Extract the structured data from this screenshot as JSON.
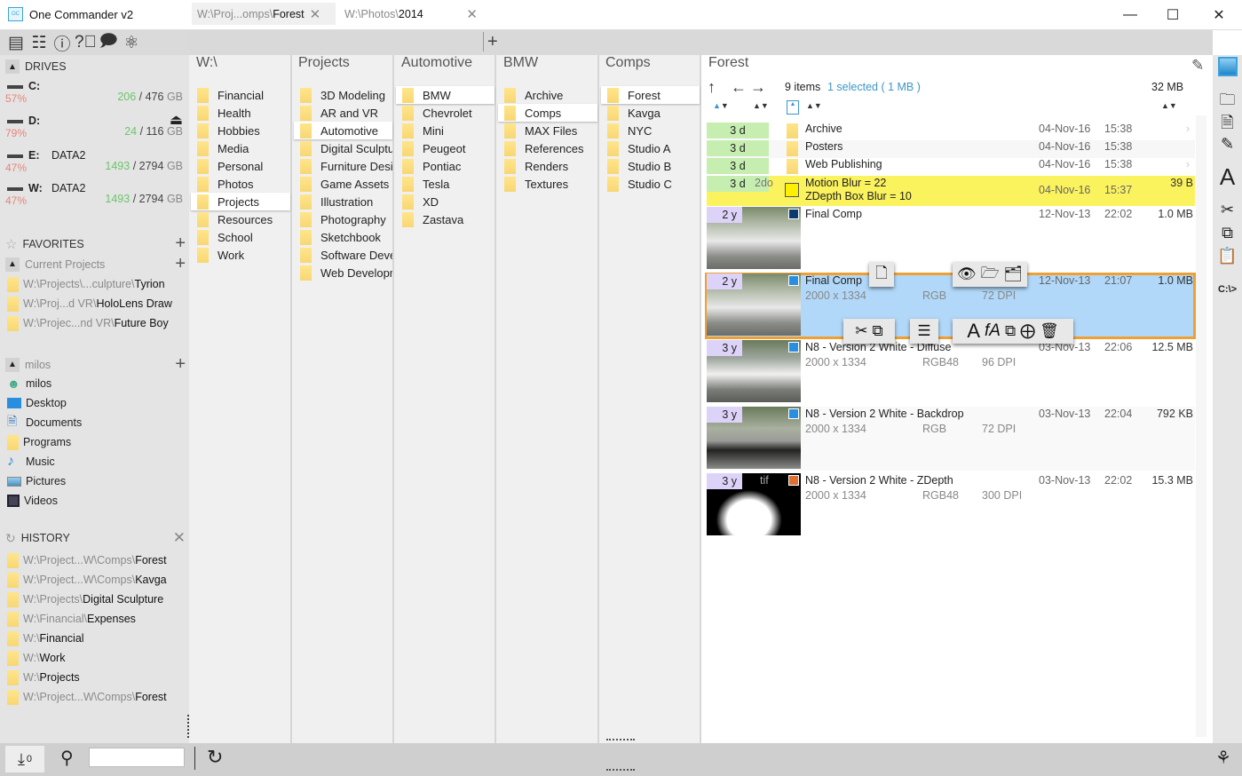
{
  "window": {
    "title": "One Commander v2",
    "app_icon": "OC",
    "controls": [
      "minimize",
      "maximize",
      "close"
    ]
  },
  "sidebar": {
    "toolbar_icons": [
      "columns-icon",
      "sliders-icon",
      "info-icon",
      "help-icon",
      "chat-icon",
      "atom-icon"
    ],
    "drives_header": "DRIVES",
    "drives": [
      {
        "letter": "C:",
        "label": "",
        "percent": "57%",
        "free": "206",
        "total": "476",
        "unit": "GB"
      },
      {
        "letter": "D:",
        "label": "",
        "percent": "79%",
        "free": "24",
        "total": "116",
        "unit": "GB",
        "eject": true
      },
      {
        "letter": "E:",
        "label": "DATA2",
        "percent": "47%",
        "free": "1493",
        "total": "2794",
        "unit": "GB"
      },
      {
        "letter": "W:",
        "label": "DATA2",
        "percent": "47%",
        "free": "1493",
        "total": "2794",
        "unit": "GB"
      }
    ],
    "favorites_header": "FAVORITES",
    "current_projects_header": "Current Projects",
    "favorites": [
      {
        "prefix": "W:\\Projects\\...culpture\\",
        "name": "Tyrion"
      },
      {
        "prefix": "W:\\Proj...d VR\\",
        "name": "HoloLens Draw"
      },
      {
        "prefix": "W:\\Projec...nd VR\\",
        "name": "Future Boy"
      }
    ],
    "user_header": "milos",
    "user_items": [
      {
        "icon": "user-icon",
        "label": "milos"
      },
      {
        "icon": "desktop-icon",
        "label": "Desktop"
      },
      {
        "icon": "document-icon",
        "label": "Documents"
      },
      {
        "icon": "folder-icon",
        "label": "Programs"
      },
      {
        "icon": "music-icon",
        "label": "Music"
      },
      {
        "icon": "pictures-icon",
        "label": "Pictures"
      },
      {
        "icon": "video-icon",
        "label": "Videos"
      }
    ],
    "history_header": "HISTORY",
    "history": [
      {
        "prefix": "W:\\Project...W\\Comps\\",
        "name": "Forest"
      },
      {
        "prefix": "W:\\Project...W\\Comps\\",
        "name": "Kavga"
      },
      {
        "prefix": "W:\\Projects\\",
        "name": "Digital Sculpture"
      },
      {
        "prefix": "W:\\Financial\\",
        "name": "Expenses"
      },
      {
        "prefix": "W:\\",
        "name": "Financial"
      },
      {
        "prefix": "W:\\",
        "name": "Work"
      },
      {
        "prefix": "W:\\",
        "name": "Projects"
      },
      {
        "prefix": "W:\\Project...W\\Comps\\",
        "name": "Forest"
      }
    ]
  },
  "tabs": [
    {
      "prefix": "W:\\Proj...omps\\",
      "name": "Forest",
      "active": true
    },
    {
      "prefix": "W:\\Photos\\",
      "name": "2014",
      "active": false
    }
  ],
  "columns": [
    {
      "title": "W:\\",
      "items": [
        "Financial",
        "Health",
        "Hobbies",
        "Media",
        "Personal",
        "Photos",
        "Projects",
        "Resources",
        "School",
        "Work"
      ],
      "selected": 6
    },
    {
      "title": "Projects",
      "items": [
        "3D Modeling",
        "AR and VR",
        "Automotive",
        "Digital Sculpture",
        "Furniture Design",
        "Game Assets",
        "Illustration",
        "Photography",
        "Sketchbook",
        "Software Development",
        "Web Development"
      ],
      "selected": 2
    },
    {
      "title": "Automotive",
      "items": [
        "BMW",
        "Chevrolet",
        "Mini",
        "Peugeot",
        "Pontiac",
        "Tesla",
        "XD",
        "Zastava"
      ],
      "selected": 0
    },
    {
      "title": "BMW",
      "items": [
        "Archive",
        "Comps",
        "MAX Files",
        "References",
        "Renders",
        "Textures"
      ],
      "selected": 1
    },
    {
      "title": "Comps",
      "items": [
        "Forest",
        "Kavga",
        "NYC",
        "Studio A",
        "Studio B",
        "Studio C"
      ],
      "selected": 0
    }
  ],
  "file_pane": {
    "title": "Forest",
    "item_count": "9 items",
    "selected_info": "1 selected ( 1 MB )",
    "total_size": "32 MB",
    "folders": [
      {
        "age": "3 d",
        "name": "Archive",
        "date": "04-Nov-16",
        "time": "15:38"
      },
      {
        "age": "3 d",
        "name": "Posters",
        "date": "04-Nov-16",
        "time": "15:38"
      },
      {
        "age": "3 d",
        "name": "Web Publishing",
        "date": "04-Nov-16",
        "time": "15:38"
      }
    ],
    "note": {
      "age": "3 d",
      "tag": "2do",
      "line1": "Motion Blur = 22",
      "line2": "ZDepth Box Blur = 10",
      "date": "04-Nov-16",
      "time": "15:37",
      "size": "39 B"
    },
    "images": [
      {
        "age": "2 y",
        "name": "Final Comp",
        "dims": "",
        "mode": "",
        "dpi": "",
        "date": "12-Nov-13",
        "time": "22:02",
        "size": "1.0 MB",
        "type": "psd"
      },
      {
        "age": "2 y",
        "name": "Final Comp",
        "dims": "2000 x 1334",
        "mode": "RGB",
        "dpi": "72 DPI",
        "date": "12-Nov-13",
        "time": "21:07",
        "size": "1.0 MB",
        "type": "image",
        "selected": true
      },
      {
        "age": "3 y",
        "name": "N8 - Version 2 White - Diffuse",
        "dims": "2000 x 1334",
        "mode": "RGB48",
        "dpi": "96 DPI",
        "date": "03-Nov-13",
        "time": "22:06",
        "size": "12.5 MB",
        "type": "image"
      },
      {
        "age": "3 y",
        "name": "N8 - Version 2 White - Backdrop",
        "dims": "2000 x 1334",
        "mode": "RGB",
        "dpi": "72 DPI",
        "date": "03-Nov-13",
        "time": "22:04",
        "size": "792 KB",
        "type": "image"
      },
      {
        "age": "3 y",
        "name": "N8 - Version 2 White - ZDepth",
        "dims": "2000 x 1334",
        "mode": "RGB48",
        "dpi": "300 DPI",
        "date": "03-Nov-13",
        "time": "22:02",
        "size": "15.3 MB",
        "type": "tif",
        "thumb_label": "tif"
      }
    ]
  },
  "context_actions": [
    "properties",
    "view",
    "extract",
    "move-to",
    "cut",
    "copy",
    "rename-list",
    "rename",
    "rename-advanced",
    "convert",
    "duplicate",
    "delete"
  ],
  "right_toolbar": [
    "image-view",
    "new-folder",
    "new-file",
    "edit",
    "font",
    "cut",
    "copy",
    "paste",
    "command-line"
  ],
  "right_cmd_label": "C:\\>",
  "bottom": {
    "queue_count": "0",
    "search_placeholder": ""
  },
  "colors": {
    "selection": "#a8d4f8",
    "selection_border": "#f0a030",
    "note": "#fbf35e",
    "age_recent": "#c6eeb0",
    "age_old": "#ddd2f8",
    "percent": "#e8847a",
    "free": "#6cc46c",
    "link": "#3c96c8"
  }
}
